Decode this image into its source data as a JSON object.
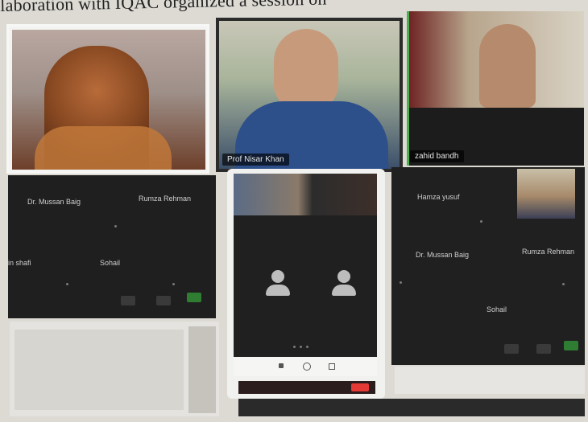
{
  "caption": "laboration with IQAC organized a session on",
  "top_row": {
    "tile1_name": "",
    "tile2_name": "Prof Nisar Khan",
    "tile3_name": "zahid bandh"
  },
  "grid_left": {
    "names": [
      "Dr. Mussan Baig",
      "Rumza Rehman",
      "in shafi",
      "Sohail"
    ]
  },
  "phone": {
    "avatar_left_label": "",
    "avatar_right_label": ""
  },
  "grid_right": {
    "names": [
      "Hamza yusuf",
      "Dr. Mussan Baig",
      "Rumza Rehman",
      "Sohail"
    ]
  },
  "colors": {
    "active_speaker": "#4caf50",
    "dark_bg": "#1f1f1f",
    "end_button": "#e53935",
    "toolbar_green": "#2e7d32"
  }
}
